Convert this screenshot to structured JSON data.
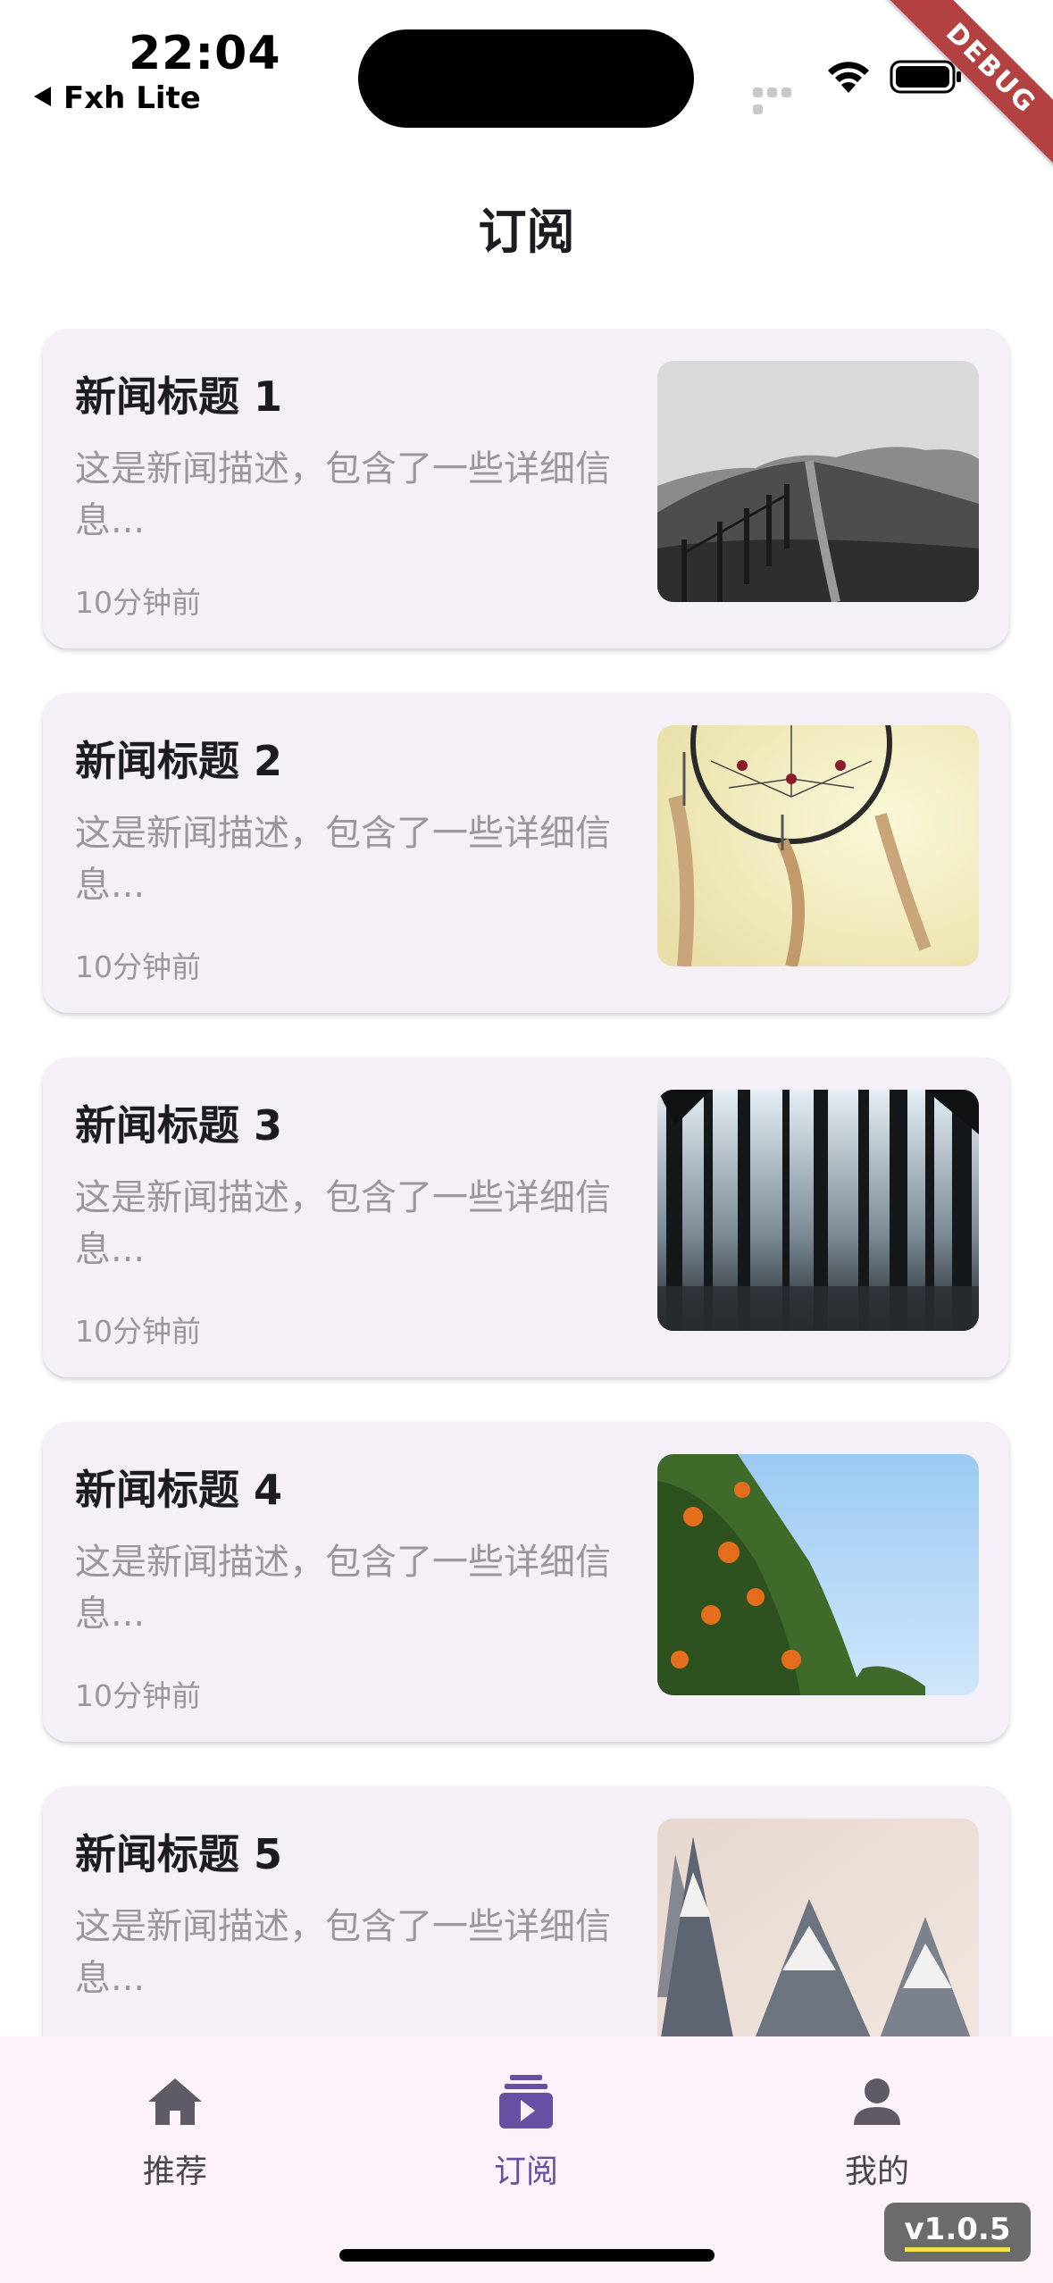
{
  "status_bar": {
    "time": "22:04",
    "back_app": "Fxh Lite",
    "debug_banner": "DEBUG"
  },
  "app_bar": {
    "title": "订阅"
  },
  "news": [
    {
      "title": "新闻标题 1",
      "description": "这是新闻描述，包含了一些详细信息...",
      "time": "10分钟前",
      "image": "hills-fence-photo"
    },
    {
      "title": "新闻标题 2",
      "description": "这是新闻描述，包含了一些详细信息...",
      "time": "10分钟前",
      "image": "dreamcatcher-photo"
    },
    {
      "title": "新闻标题 3",
      "description": "这是新闻描述，包含了一些详细信息...",
      "time": "10分钟前",
      "image": "forest-photo"
    },
    {
      "title": "新闻标题 4",
      "description": "这是新闻描述，包含了一些详细信息...",
      "time": "10分钟前",
      "image": "orange-tree-photo"
    },
    {
      "title": "新闻标题 5",
      "description": "这是新闻描述，包含了一些详细信息...",
      "time": "",
      "image": "snowy-trees-photo"
    }
  ],
  "bottom_nav": {
    "items": [
      {
        "label": "推荐",
        "icon": "home-icon",
        "active": false
      },
      {
        "label": "订阅",
        "icon": "subscriptions-icon",
        "active": true
      },
      {
        "label": "我的",
        "icon": "person-icon",
        "active": false
      }
    ]
  },
  "version": "v1.0.5",
  "colors": {
    "accent": "#6750a4",
    "card_bg": "#f5f0f7",
    "nav_bg": "#fcf3fa",
    "secondary_text": "#9a969c"
  }
}
